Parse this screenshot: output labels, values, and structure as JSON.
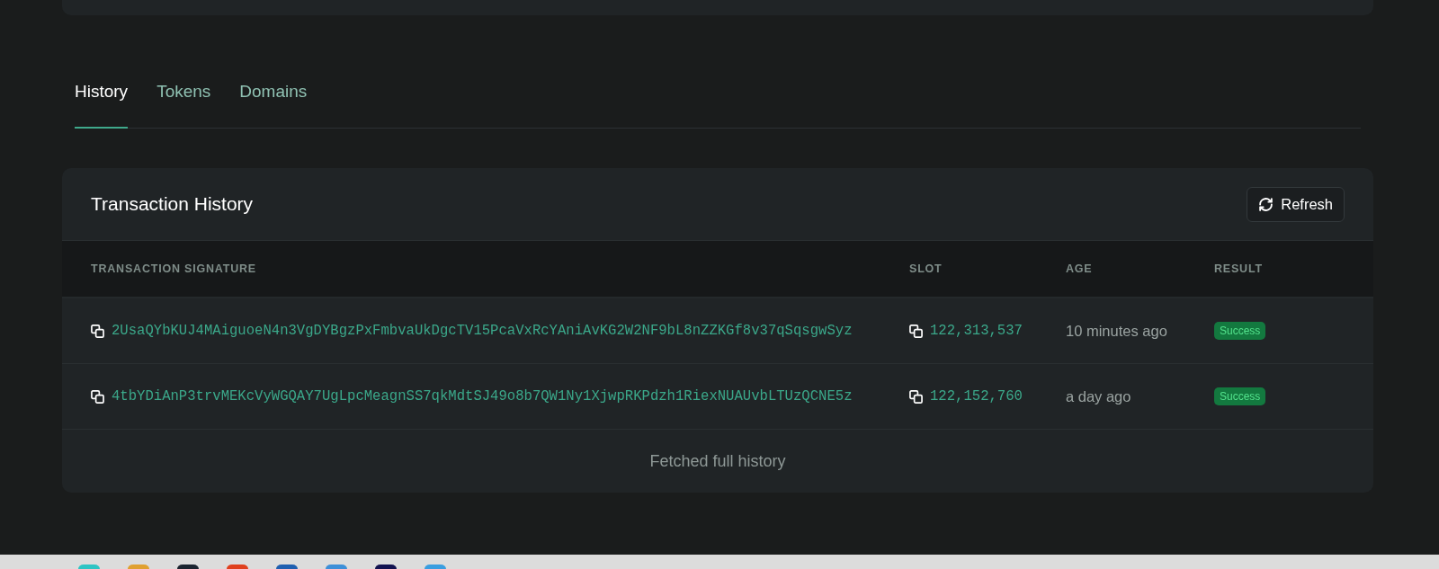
{
  "tabs": [
    {
      "label": "History",
      "selected": true
    },
    {
      "label": "Tokens",
      "selected": false
    },
    {
      "label": "Domains",
      "selected": false
    }
  ],
  "card": {
    "title": "Transaction History",
    "refresh_button": "Refresh"
  },
  "table": {
    "columns": [
      "TRANSACTION SIGNATURE",
      "SLOT",
      "AGE",
      "RESULT"
    ],
    "rows": [
      {
        "signature": "2UsaQYbKUJ4MAiguoeN4n3VgDYBgzPxFmbvaUkDgcTV15PcaVxRcYAniAvKG2W2NF9bL8nZZKGf8v37qSqsgwSyz",
        "slot": "122,313,537",
        "age": "10 minutes ago",
        "result": "Success",
        "kind": "success"
      },
      {
        "signature": "4tbYDiAnP3trvMEKcVyWGQAY7UgLpcMeagnSS7qkMdtSJ49o8b7QW1Ny1XjwpRKPdzh1RiexNUAUvbLTUzQCNE5z",
        "slot": "122,152,760",
        "age": "a day ago",
        "result": "Success",
        "kind": "success"
      }
    ]
  },
  "footer": "Fetched full history"
}
